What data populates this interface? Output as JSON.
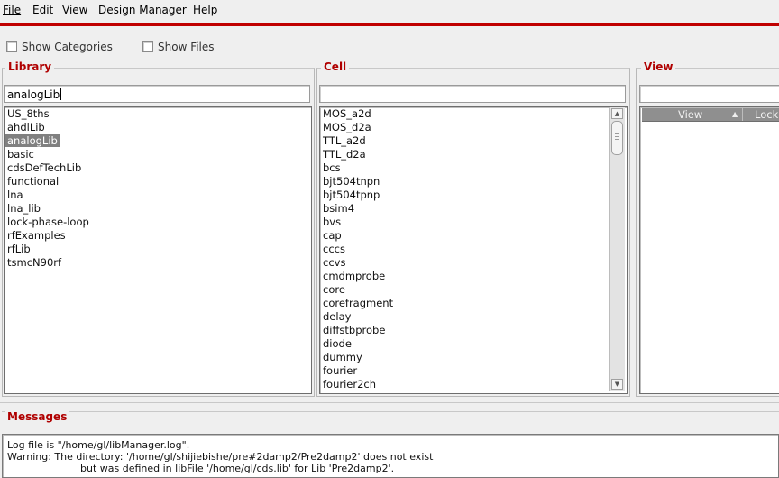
{
  "menu": {
    "file": "File",
    "edit": "Edit",
    "view": "View",
    "design_manager": "Design Manager",
    "help": "Help"
  },
  "options": {
    "show_categories": "Show Categories",
    "show_files": "Show Files"
  },
  "library": {
    "title": "Library",
    "filter_value": "analogLib",
    "selected": "analogLib",
    "items": [
      "US_8ths",
      "ahdlLib",
      "analogLib",
      "basic",
      "cdsDefTechLib",
      "functional",
      "lna",
      "lna_lib",
      "lock-phase-loop",
      "rfExamples",
      "rfLib",
      "tsmcN90rf"
    ]
  },
  "cell": {
    "title": "Cell",
    "filter_value": "",
    "items": [
      "MOS_a2d",
      "MOS_d2a",
      "TTL_a2d",
      "TTL_d2a",
      "bcs",
      "bjt504tnpn",
      "bjt504tpnp",
      "bsim4",
      "bvs",
      "cap",
      "cccs",
      "ccvs",
      "cmdmprobe",
      "core",
      "corefragment",
      "delay",
      "diffstbprobe",
      "diode",
      "dummy",
      "fourier",
      "fourier2ch"
    ]
  },
  "view": {
    "title": "View",
    "filter_value": "",
    "columns": [
      "View",
      "Lock"
    ]
  },
  "messages": {
    "title": "Messages",
    "lines": [
      "Log file is \"/home/gl/libManager.log\".",
      "Warning: The directory: '/home/gl/shijiebishe/pre#2damp2/Pre2damp2' does not exist",
      "but was defined in libFile '/home/gl/cds.lib' for Lib 'Pre2damp2'."
    ]
  },
  "colors": {
    "accent_red": "#c00000",
    "title_red": "#b00000",
    "selection_gray": "#808080"
  }
}
